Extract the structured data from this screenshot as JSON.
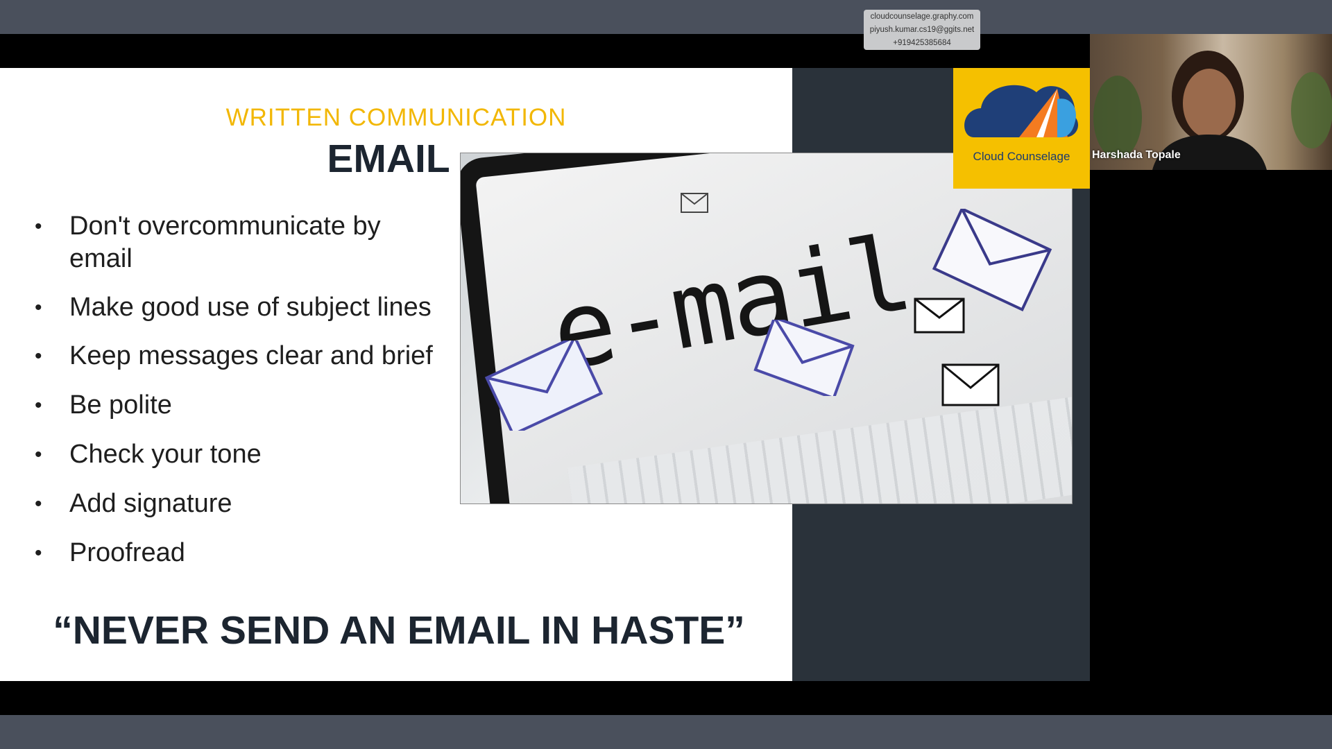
{
  "watermark": {
    "line1": "cloudcounselage.graphy.com",
    "line2": "piyush.kumar.cs19@ggits.net",
    "line3": "+919425385684"
  },
  "slide": {
    "subtitle": "WRITTEN COMMUNICATION",
    "title": "EMAIL",
    "bullets": [
      "Don't overcommunicate by email",
      "Make good use of subject lines",
      "Keep messages clear and brief",
      "Be polite",
      "Check your tone",
      "Add signature",
      "Proofread"
    ],
    "quote": "“NEVER SEND AN EMAIL IN HASTE”",
    "image_word": "e-mail"
  },
  "logo": {
    "text": "Cloud Counselage"
  },
  "participant": {
    "name": "Harshada Topale"
  },
  "colors": {
    "accent_yellow": "#f2b705",
    "logo_yellow": "#f5c000",
    "title_navy": "#1c2530",
    "meeting_bg": "#4a505c"
  }
}
